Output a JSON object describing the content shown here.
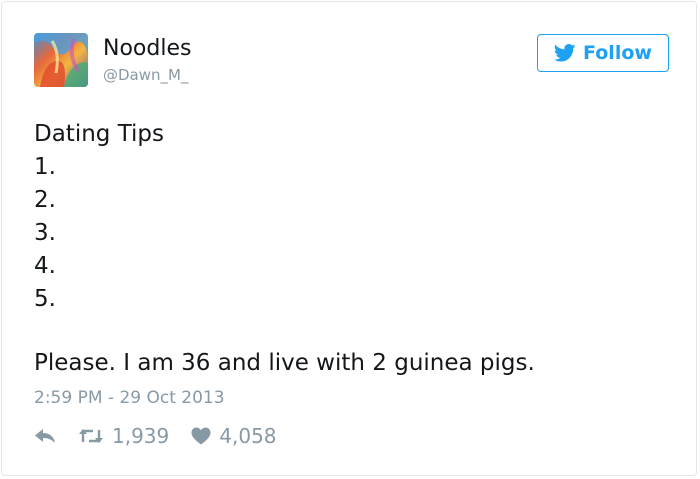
{
  "tweet": {
    "author_name": "Noodles",
    "author_handle": "@Dawn_M_",
    "follow_label": "Follow",
    "lines": [
      "Dating Tips",
      "1.",
      "2.",
      "3.",
      "4.",
      "5."
    ],
    "closing_line": "Please. I am 36 and live with 2 guinea pigs.",
    "timestamp": "2:59 PM - 29 Oct 2013",
    "retweet_count": "1,939",
    "like_count": "4,058"
  },
  "icons": {
    "follow": "twitter-bird-icon",
    "reply": "reply-arrow-icon",
    "retweet": "retweet-icon",
    "like": "heart-icon"
  },
  "colors": {
    "accent": "#1da1f2",
    "muted": "#8899a6",
    "text": "#14171a",
    "border": "#e1e8ed"
  }
}
